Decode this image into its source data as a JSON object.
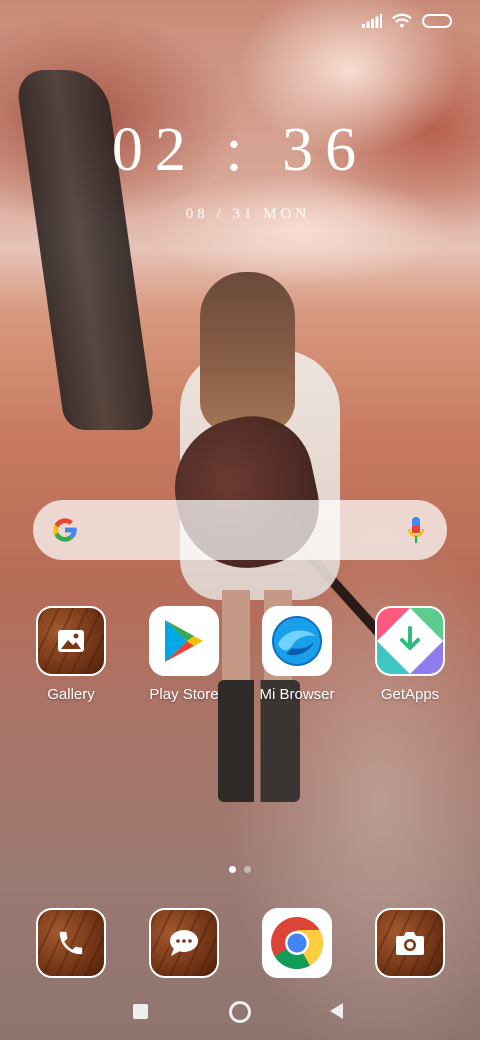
{
  "status_bar": {
    "signal_icon": "cellular-signal-icon",
    "wifi_icon": "wifi-icon",
    "battery_icon": "battery-icon"
  },
  "lock_widget": {
    "time": "02 : 36",
    "date": "08 / 31 MON"
  },
  "search": {
    "provider_icon": "google-g-icon",
    "mic_icon": "microphone-icon"
  },
  "apps": [
    {
      "label": "Gallery",
      "icon": "gallery-image-icon"
    },
    {
      "label": "Play Store",
      "icon": "play-store-icon"
    },
    {
      "label": "Mi Browser",
      "icon": "mi-browser-icon"
    },
    {
      "label": "GetApps",
      "icon": "getapps-icon"
    }
  ],
  "dock": [
    {
      "icon": "phone-icon"
    },
    {
      "icon": "messages-icon"
    },
    {
      "icon": "chrome-icon"
    },
    {
      "icon": "camera-icon"
    }
  ],
  "page_indicator": {
    "current": 1,
    "total": 2
  },
  "nav_bar": {
    "recents_icon": "recents-square-icon",
    "home_icon": "home-circle-icon",
    "back_icon": "back-triangle-icon"
  },
  "colors": {
    "google_blue": "#4285F4",
    "google_red": "#EA4335",
    "google_yellow": "#FBBC05",
    "google_green": "#34A853",
    "wood": "#8a4220"
  }
}
